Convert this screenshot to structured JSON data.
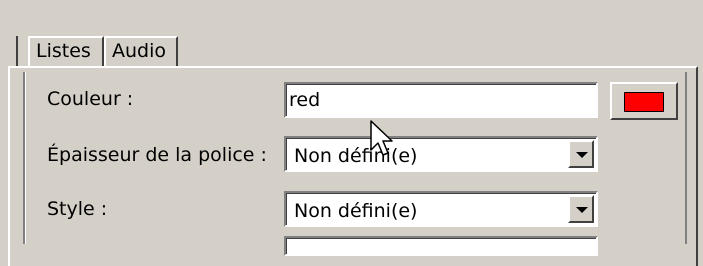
{
  "tabs": {
    "listes": "Listes",
    "audio": "Audio"
  },
  "fields": {
    "color": {
      "label": "Couleur :",
      "value": "red"
    },
    "font_weight": {
      "label": "Épaisseur de la police :",
      "value": "Non défini(e)"
    },
    "style": {
      "label": "Style :",
      "value": "Non défini(e)"
    }
  },
  "colors": {
    "swatch": "#ff0000",
    "face": "#d4d0c8"
  },
  "icons": {
    "cursor": "mouse-pointer-icon",
    "dropdown": "chevron-down-icon"
  }
}
